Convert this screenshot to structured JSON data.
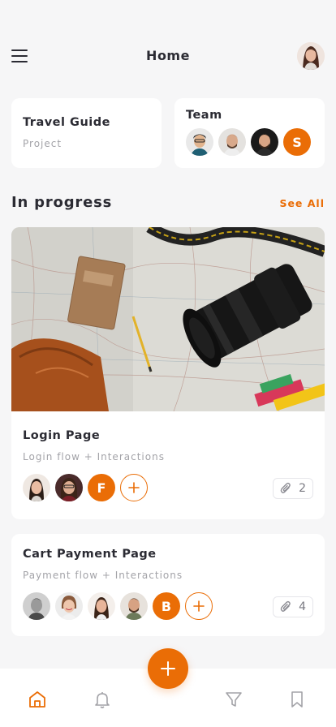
{
  "header": {
    "title": "Home"
  },
  "cards": {
    "travel": {
      "title": "Travel Guide",
      "subtitle": "Project"
    },
    "team": {
      "title": "Team",
      "extra_member_initial": "S"
    }
  },
  "section": {
    "title": "In progress",
    "see_all_label": "See All"
  },
  "tasks": [
    {
      "title": "Login Page",
      "subtitle": "Login flow + Interactions",
      "member_initial": "F",
      "attachments": "2"
    },
    {
      "title": "Cart Payment Page",
      "subtitle": "Payment flow + Interactions",
      "member_initial": "B",
      "attachments": "4"
    }
  ],
  "icons": {
    "menu": "menu-icon",
    "home": "home-icon",
    "bell": "bell-icon",
    "filter": "filter-icon",
    "bookmark": "bookmark-icon",
    "add": "plus-icon",
    "attach": "paperclip-icon"
  },
  "colors": {
    "accent": "#ea6d06",
    "background": "#f6f6f7",
    "card": "#ffffff",
    "text": "#2b2b33",
    "muted": "#a3a3a8"
  }
}
